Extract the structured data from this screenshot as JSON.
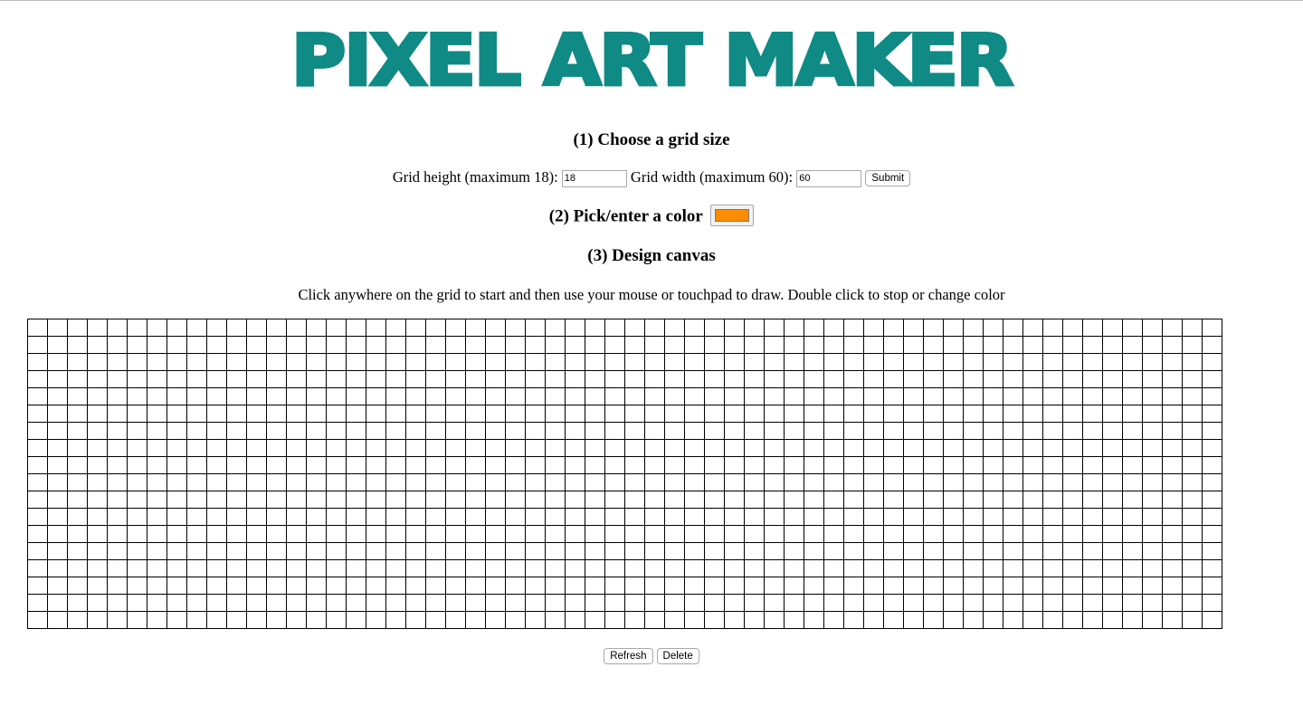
{
  "logo": {
    "text": "PIXEL ART MAKER",
    "color": "#0f8a85"
  },
  "step1": {
    "heading": "(1) Choose a grid size",
    "height_label": "Grid height (maximum 18):",
    "height_value": "18",
    "width_label": "Grid width (maximum 60):",
    "width_value": "60",
    "submit_label": "Submit"
  },
  "step2": {
    "heading": "(2) Pick/enter a color",
    "color_value": "#ff8c00"
  },
  "step3": {
    "heading": "(3) Design canvas",
    "instructions": "Click anywhere on the grid to start and then use your mouse or touchpad to draw. Double click to stop or change color"
  },
  "canvas": {
    "rows": 18,
    "cols": 60
  },
  "buttons": {
    "refresh_label": "Refresh",
    "delete_label": "Delete"
  }
}
